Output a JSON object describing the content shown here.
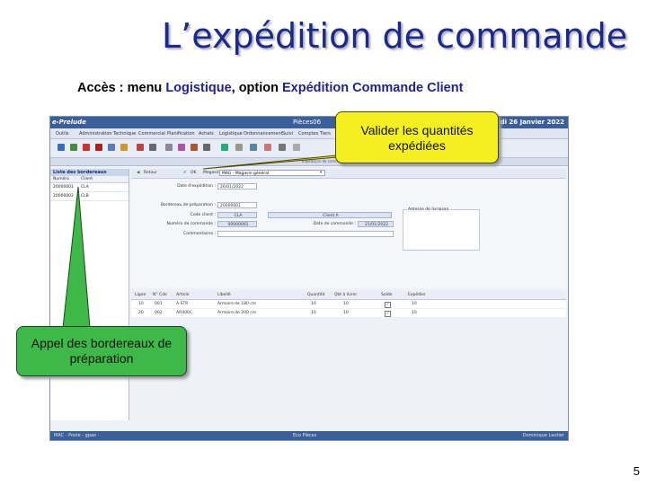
{
  "slide": {
    "title": "L’expédition de commande",
    "subtitle_prefix": "Accès : menu ",
    "subtitle_menu": "Logistique",
    "subtitle_mid": ", option ",
    "subtitle_option": "Expédition Commande Client",
    "page_number": "5"
  },
  "callouts": {
    "valider": "Valider les quantités expédiées",
    "appel": "Appel des bordereaux de préparation"
  },
  "app": {
    "title_left": "e-Prelude",
    "title_center": "Pièces06",
    "title_date": "Mercredi 26 Janvier 2022",
    "menu": [
      "Outils",
      "Administration",
      "Technique",
      "Commercial",
      "Planification",
      "Achats",
      "Logistique",
      "Ordonnancement",
      "Suivi",
      "Comptes Tiers"
    ],
    "tabstrip_label": "Expédition de commande",
    "left_panel": {
      "title": "Liste des bordereaux",
      "columns": [
        "Numéro",
        "Client"
      ],
      "rows": [
        {
          "numero": "20000001",
          "client": "CLA"
        },
        {
          "numero": "20000002",
          "client": "CLB"
        }
      ]
    },
    "toolbar2": {
      "retour": "Retour",
      "ok": "OK",
      "magasin_label": "Magasin",
      "magasin_value": "MAG - Magasin général"
    },
    "form": {
      "date_expedition_label": "Date d'expédition :",
      "date_expedition_value": "26/01/2022",
      "bordereau_label": "Bordereau de préparation :",
      "bordereau_value": "20000001",
      "code_client_label": "Code client :",
      "code_client_value": "CLA",
      "client_name": "Client A",
      "num_commande_label": "Numéro de commande :",
      "num_commande_value": "00000001",
      "date_commande_label": "Date de commande :",
      "date_commande_value": "21/01/2022",
      "commentaires_label": "Commentaires :",
      "adresse_title": "Adresse de livraison"
    },
    "grid": {
      "columns": [
        "Ligne",
        "N° Cde",
        "Article",
        "Libellé",
        "Quantité",
        "Qté à livrer",
        "Solde",
        "Expédier"
      ],
      "rows": [
        {
          "ligne": "10",
          "cde": "001",
          "article": "A-STR",
          "libelle": "Armoire de 180 cm",
          "quantite": "10",
          "qte": "10",
          "solde": "✓",
          "expedier": "10"
        },
        {
          "ligne": "20",
          "cde": "002",
          "article": "AR400C",
          "libelle": "Armoire de 200 cm",
          "quantite": "10",
          "qte": "10",
          "solde": "✓",
          "expedier": "10"
        }
      ]
    },
    "status": {
      "left": "MAC - Poste - gpao -",
      "center": "Eco Pièces",
      "right": "Dominique Lautier"
    }
  }
}
